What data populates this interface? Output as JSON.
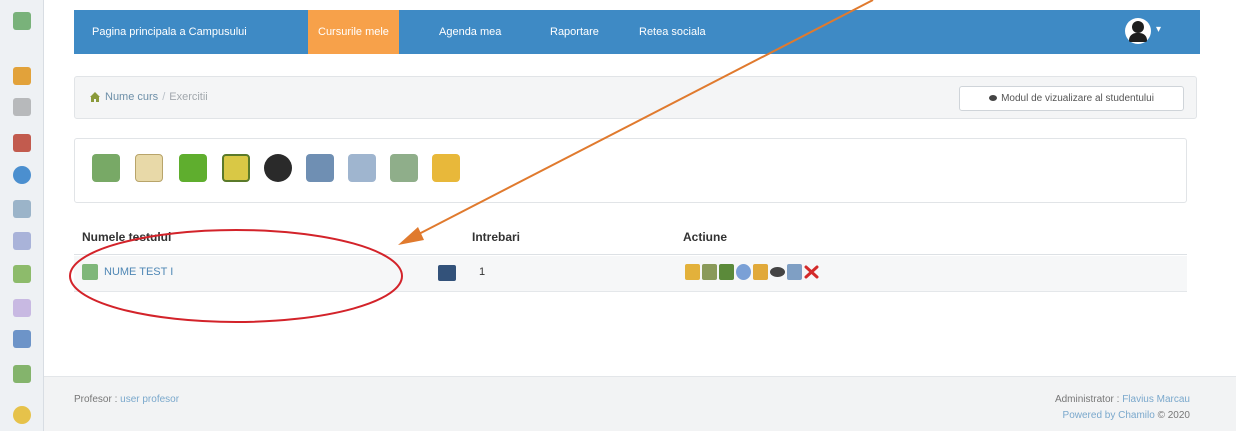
{
  "strip_icons": [
    "tools-icon",
    "user-icon",
    "document-icon",
    "shapes-icon",
    "clock-icon",
    "library-icon",
    "notebook-icon",
    "users-icon",
    "eraser-icon",
    "person-icon",
    "group-icon",
    "chat-icon"
  ],
  "navbar": {
    "items": [
      {
        "label": "Pagina principala a Campusului",
        "active": false
      },
      {
        "label": "Cursurile mele",
        "active": true
      },
      {
        "label": "Agenda mea",
        "active": false
      },
      {
        "label": "Raportare",
        "active": false
      },
      {
        "label": "Retea sociala",
        "active": false
      }
    ],
    "avatar_icon": "user-avatar-icon",
    "caret": "▾"
  },
  "breadcrumb": {
    "course": "Nume curs",
    "separator": "/",
    "current": "Exercitii"
  },
  "student_view_button": "Modul de vizualizare al studentului",
  "toolbar_icons": [
    "new-test-icon",
    "question-icon",
    "folder-icon",
    "ai-icon",
    "avatar-face-icon",
    "save-icon",
    "import-icon",
    "import-alt-icon",
    "clean-icon"
  ],
  "table": {
    "headers": {
      "name": "Numele testului",
      "questions": "Intrebari",
      "actions": "Actiune"
    },
    "rows": [
      {
        "name": "NUME TEST I",
        "questions": "1",
        "actions": [
          "edit-icon",
          "statistics-icon",
          "chart-icon",
          "preview-icon",
          "clean-icon",
          "visibility-icon",
          "export-icon",
          "delete-icon"
        ]
      }
    ]
  },
  "footer": {
    "teacher_label": "Profesor :",
    "teacher_name": "user profesor",
    "admin_label": "Administrator :",
    "admin_name": "Flavius Marcau",
    "powered_text": "Powered by Chamilo",
    "copyright": "© 2020"
  },
  "colors": {
    "navbar": "#3e8ac5",
    "nav_active": "#f7a14a",
    "annotation_arrow": "#e07a2e",
    "annotation_ellipse": "#d3232a"
  }
}
